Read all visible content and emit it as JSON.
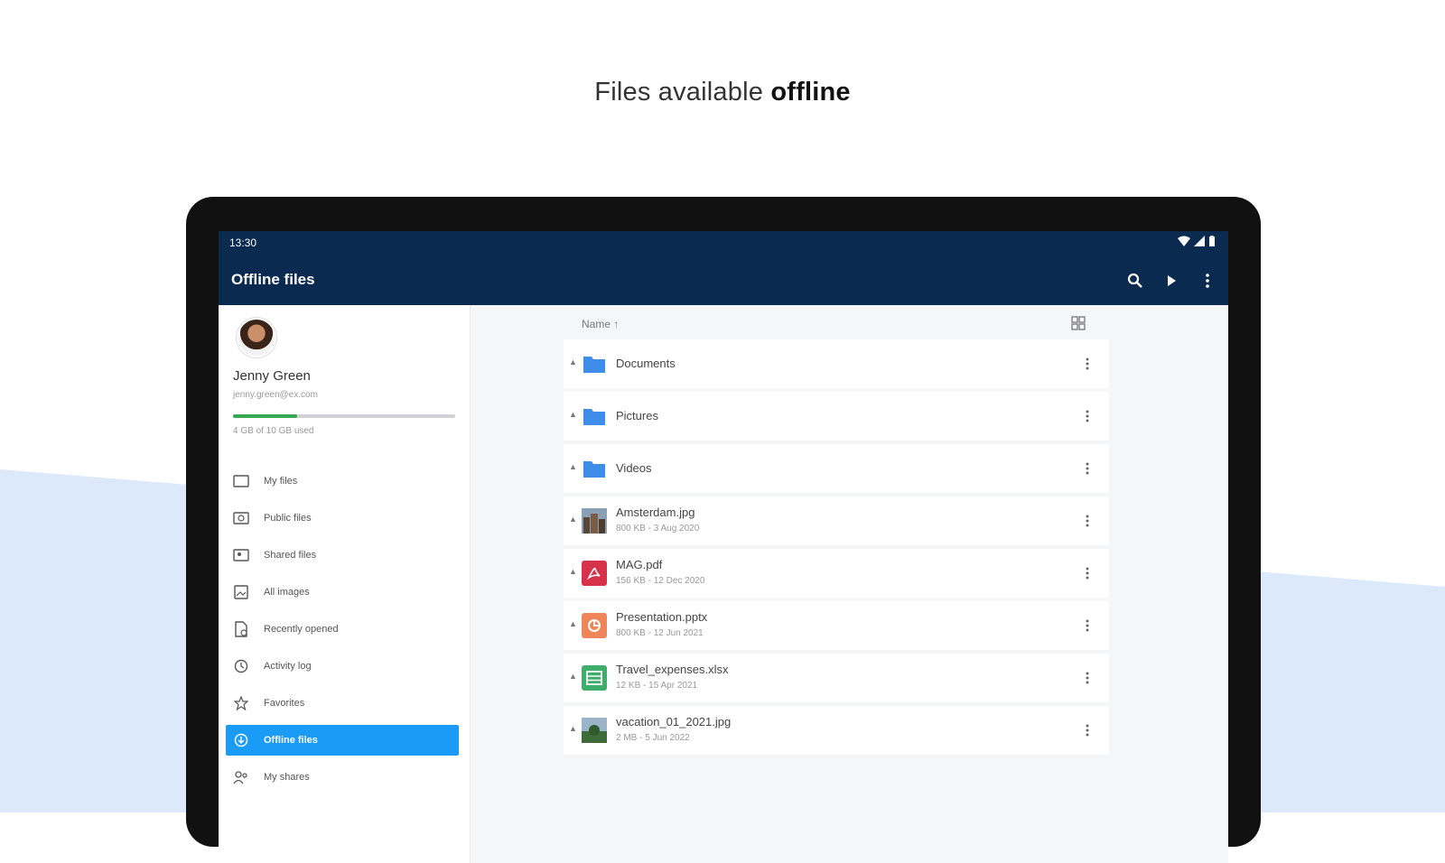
{
  "headline": {
    "regular": "Files available ",
    "bold": "offline"
  },
  "status": {
    "time": "13:30"
  },
  "appbar": {
    "title": "Offline files"
  },
  "user": {
    "name": "Jenny Green",
    "email": "jenny.green@ex.com",
    "storage": "4 GB of 10 GB used",
    "storage_used_fraction": 0.29
  },
  "nav": {
    "items": [
      {
        "label": "My files",
        "icon": "folder-outline-icon"
      },
      {
        "label": "Public files",
        "icon": "public-folder-icon"
      },
      {
        "label": "Shared files",
        "icon": "shared-folder-icon"
      },
      {
        "label": "All images",
        "icon": "image-icon"
      },
      {
        "label": "Recently opened",
        "icon": "recent-file-icon"
      },
      {
        "label": "Activity log",
        "icon": "history-icon"
      },
      {
        "label": "Favorites",
        "icon": "star-icon"
      },
      {
        "label": "Offline files",
        "icon": "offline-icon",
        "active": true
      },
      {
        "label": "My shares",
        "icon": "shares-icon"
      }
    ]
  },
  "content": {
    "sort_label": "Name ↑",
    "files": [
      {
        "name": "Documents",
        "meta": "",
        "type": "folder"
      },
      {
        "name": "Pictures",
        "meta": "",
        "type": "folder"
      },
      {
        "name": "Videos",
        "meta": "",
        "type": "folder"
      },
      {
        "name": "Amsterdam.jpg",
        "meta": "800 KB - 3 Aug 2020",
        "type": "image"
      },
      {
        "name": "MAG.pdf",
        "meta": "156 KB - 12 Dec 2020",
        "type": "pdf"
      },
      {
        "name": "Presentation.pptx",
        "meta": "800 KB - 12 Jun 2021",
        "type": "pptx"
      },
      {
        "name": "Travel_expenses.xlsx",
        "meta": "12 KB - 15 Apr 2021",
        "type": "xlsx"
      },
      {
        "name": "vacation_01_2021.jpg",
        "meta": "2 MB - 5 Jun 2022",
        "type": "image"
      }
    ]
  },
  "colors": {
    "appbar": "#0b2a4f",
    "accent": "#1a9bf5",
    "storage": "#34a853",
    "background_wave": "#dbe9fb"
  }
}
